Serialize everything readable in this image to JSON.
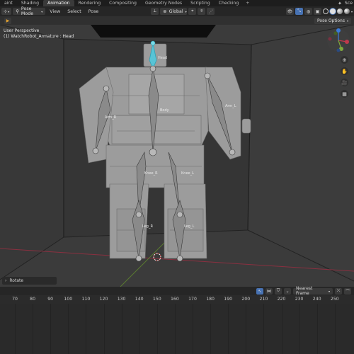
{
  "workspace_tabs": [
    {
      "label": "aint",
      "active": false
    },
    {
      "label": "Shading",
      "active": false
    },
    {
      "label": "Animation",
      "active": true
    },
    {
      "label": "Rendering",
      "active": false
    },
    {
      "label": "Compositing",
      "active": false
    },
    {
      "label": "Geometry Nodes",
      "active": false
    },
    {
      "label": "Scripting",
      "active": false
    },
    {
      "label": "Checking",
      "active": false
    }
  ],
  "add_tab": "+",
  "scene_label": "Sce",
  "header": {
    "mode": "Pose Mode",
    "menus": [
      "View",
      "Select",
      "Pose"
    ],
    "orientation": "Global"
  },
  "pose_options": "Pose Options",
  "viewport": {
    "perspective": "User Perspective",
    "object": "(1) WatchRobot_Armature : Head"
  },
  "bone_labels": [
    {
      "name": "Head"
    },
    {
      "name": "Arm_R"
    },
    {
      "name": "Body"
    },
    {
      "name": "Arm_L"
    },
    {
      "name": "Knee_R"
    },
    {
      "name": "Knee_L"
    },
    {
      "name": "Leg_R"
    },
    {
      "name": "Leg_L"
    }
  ],
  "operator_panel": "Rotate",
  "timeline": {
    "keying": "Nearest Frame",
    "frames": [
      "70",
      "80",
      "90",
      "100",
      "110",
      "120",
      "130",
      "140",
      "150",
      "160",
      "170",
      "180",
      "190",
      "200",
      "210",
      "220",
      "230",
      "240",
      "250"
    ]
  },
  "colors": {
    "accent": "#4772b3",
    "bone": "#9a9a9a",
    "selected_bone": "#5ec8d8",
    "x_axis": "#c0394c",
    "y_axis": "#7fa83a",
    "z_axis": "#3a7ad8"
  }
}
